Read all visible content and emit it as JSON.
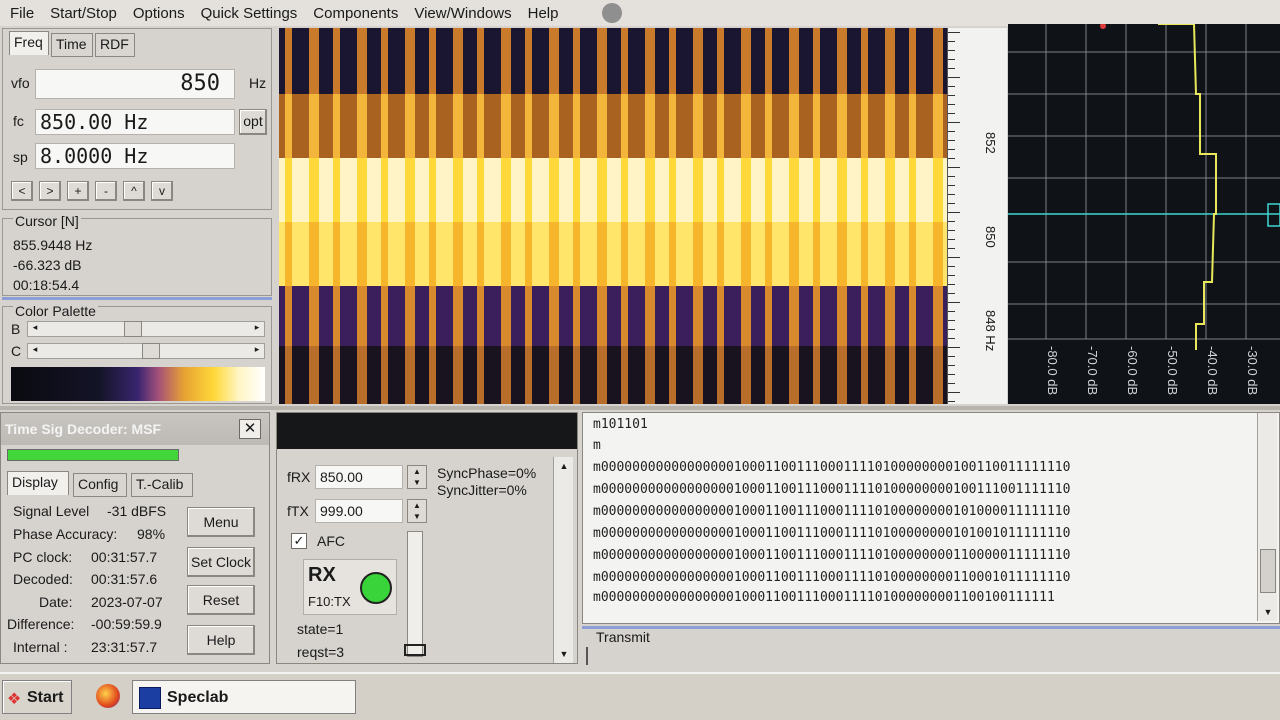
{
  "menu": [
    "File",
    "Start/Stop",
    "Options",
    "Quick Settings",
    "Components",
    "View/Windows",
    "Help"
  ],
  "freq_panel": {
    "tabs": [
      "Freq",
      "Time",
      "RDF"
    ],
    "vfo_label": "vfo",
    "vfo_value": "850",
    "vfo_unit": "Hz",
    "fc_label": "fc",
    "fc_value": "850.00 Hz",
    "opt_label": "opt",
    "sp_label": "sp",
    "sp_value": "8.0000 Hz",
    "nav_buttons": [
      "<",
      ">",
      "+",
      "-",
      "^",
      "v"
    ]
  },
  "cursor": {
    "title": "Cursor [N]",
    "freq": "855.9448 Hz",
    "level": "-66.323 dB",
    "time": "00:18:54.4"
  },
  "palette": {
    "title": "Color Palette",
    "b_label": "B",
    "c_label": "C",
    "b_level": 0.47,
    "c_level": 0.55
  },
  "freq_axis": {
    "labels": [
      "852",
      "850",
      "848 Hz"
    ]
  },
  "spectrum": {
    "db_labels": [
      "-80.0 dB",
      "-70.0 dB",
      "-60.0 dB",
      "-50.0 dB",
      "-40.0 dB",
      "-30.0 dB"
    ]
  },
  "decoder": {
    "title": "Time Sig Decoder: MSF",
    "tabs": [
      "Display",
      "Config",
      "T.-Calib"
    ],
    "rows": [
      {
        "label": "Signal Level",
        "value": "-31 dBFS"
      },
      {
        "label": "Phase Accuracy:",
        "value": "98%"
      },
      {
        "label": "PC clock:",
        "value": "00:31:57.7"
      },
      {
        "label": "Decoded:",
        "value": "00:31:57.6"
      },
      {
        "label": "Date:",
        "value": "2023-07-07"
      },
      {
        "label": "Difference:",
        "value": "-00:59:59.9"
      },
      {
        "label": "Internal :",
        "value": "23:31:57.7"
      }
    ],
    "buttons": [
      "Menu",
      "Set Clock",
      "Reset",
      "Help"
    ]
  },
  "afc": {
    "frx_label": "fRX",
    "frx_value": "850.00",
    "ftx_label": "fTX",
    "ftx_value": "999.00",
    "sync_phase": "SyncPhase=0%",
    "sync_jitter": "SyncJitter=0%",
    "afc_label": "AFC",
    "rx_label": "RX",
    "tx_key": "F10:TX",
    "state": "state=1",
    "reqst": "reqst=3"
  },
  "log": {
    "lines": [
      "m101101",
      "m",
      "m000000000000000001000110011100011110100000000100110011111110",
      "m000000000000000001000110011100011110100000000100111001111110",
      "m000000000000000001000110011100011110100000000101000011111110",
      "m000000000000000001000110011100011110100000000101001011111110",
      "m000000000000000001000110011100011110100000000110000011111110",
      "m000000000000000001000110011100011110100000000110001011111110",
      "m0000000000000000010001100111000111101000000001100100111111"
    ]
  },
  "transmit": {
    "title": "Transmit"
  },
  "taskbar": {
    "start": "Start",
    "app": "Speclab"
  }
}
